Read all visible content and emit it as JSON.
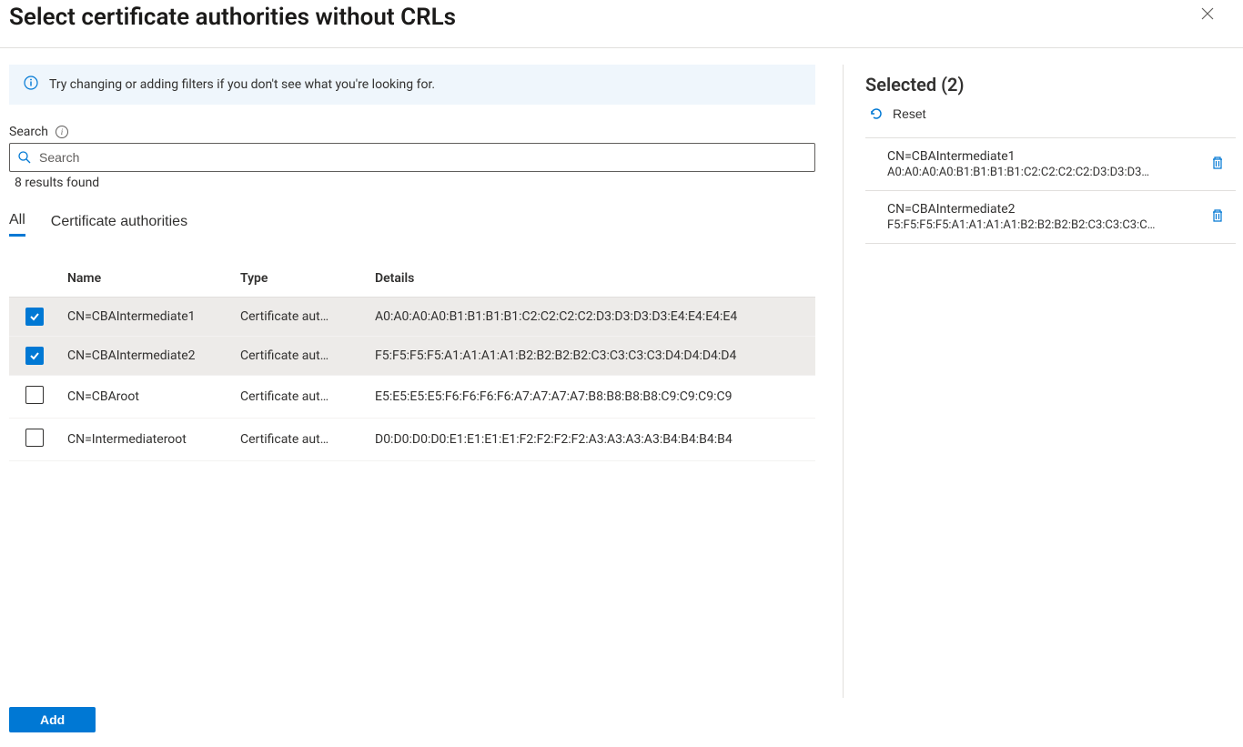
{
  "header": {
    "title": "Select certificate authorities without CRLs"
  },
  "info_banner": "Try changing or adding filters if you don't see what you're looking for.",
  "search": {
    "label": "Search",
    "placeholder": "Search",
    "results_text": "8 results found"
  },
  "tabs": {
    "all": "All",
    "ca": "Certificate authorities"
  },
  "table": {
    "columns": {
      "name": "Name",
      "type": "Type",
      "details": "Details"
    },
    "rows": [
      {
        "selected": true,
        "name": "CN=CBAIntermediate1",
        "type": "Certificate aut…",
        "details": "A0:A0:A0:A0:B1:B1:B1:B1:C2:C2:C2:C2:D3:D3:D3:D3:E4:E4:E4:E4"
      },
      {
        "selected": true,
        "name": "CN=CBAIntermediate2",
        "type": "Certificate aut…",
        "details": "F5:F5:F5:F5:A1:A1:A1:A1:B2:B2:B2:B2:C3:C3:C3:C3:D4:D4:D4:D4"
      },
      {
        "selected": false,
        "name": "CN=CBAroot",
        "type": "Certificate aut…",
        "details": "E5:E5:E5:E5:F6:F6:F6:F6:A7:A7:A7:A7:B8:B8:B8:B8:C9:C9:C9:C9"
      },
      {
        "selected": false,
        "name": "CN=Intermediateroot",
        "type": "Certificate aut…",
        "details": "D0:D0:D0:D0:E1:E1:E1:E1:F2:F2:F2:F2:A3:A3:A3:A3:B4:B4:B4:B4"
      }
    ]
  },
  "selected_panel": {
    "title": "Selected (2)",
    "reset": "Reset",
    "items": [
      {
        "name": "CN=CBAIntermediate1",
        "detail": "A0:A0:A0:A0:B1:B1:B1:B1:C2:C2:C2:C2:D3:D3:D3…"
      },
      {
        "name": "CN=CBAIntermediate2",
        "detail": "F5:F5:F5:F5:A1:A1:A1:A1:B2:B2:B2:B2:C3:C3:C3:C…"
      }
    ]
  },
  "footer": {
    "add": "Add"
  }
}
